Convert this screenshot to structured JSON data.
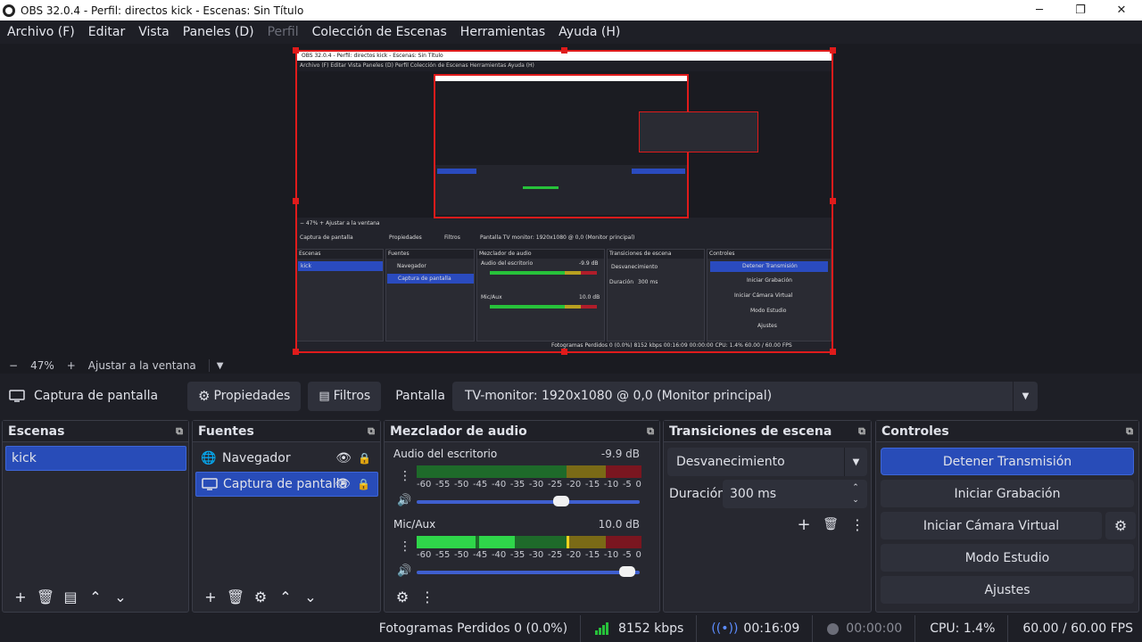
{
  "window": {
    "title": "OBS 32.0.4 - Perfil: directos kick - Escenas: Sin Título",
    "minimize": "─",
    "maximize": "❐",
    "close": "✕"
  },
  "menu": {
    "archivo": "Archivo (F)",
    "editar": "Editar",
    "vista": "Vista",
    "paneles": "Paneles (D)",
    "perfil": "Perfil",
    "coleccion": "Colección de Escenas",
    "herramientas": "Herramientas",
    "ayuda": "Ayuda (H)"
  },
  "zoom": {
    "minus": "−",
    "level": "47%",
    "plus": "+",
    "fit_label": "Ajustar a la ventana",
    "dropdown": "▼"
  },
  "context": {
    "source_icon": "monitor-icon",
    "source_name": "Captura de pantalla",
    "properties_label": "Propiedades",
    "filters_label": "Filtros",
    "display_label": "Pantalla",
    "display_value": "TV-monitor: 1920x1080 @ 0,0 (Monitor principal)"
  },
  "scenes": {
    "title": "Escenas",
    "items": [
      "kick"
    ]
  },
  "sources": {
    "title": "Fuentes",
    "items": [
      {
        "name": "Navegador",
        "icon": "globe-icon",
        "selected": false
      },
      {
        "name": "Captura de pantalla",
        "icon": "monitor-icon",
        "selected": true
      }
    ]
  },
  "mixer": {
    "title": "Mezclador de audio",
    "channels": [
      {
        "name": "Audio del escritorio",
        "db": "-9.9 dB",
        "volume": 0.66
      },
      {
        "name": "Mic/Aux",
        "db": "10.0 dB",
        "volume": 0.98
      }
    ],
    "ticks": [
      "-60",
      "-55",
      "-50",
      "-45",
      "-40",
      "-35",
      "-30",
      "-25",
      "-20",
      "-15",
      "-10",
      "-5",
      "0"
    ]
  },
  "transitions": {
    "title": "Transiciones de escena",
    "type": "Desvanecimiento",
    "duration_label": "Duración",
    "duration_value": "300 ms"
  },
  "controls": {
    "title": "Controles",
    "stop_stream": "Detener Transmisión",
    "start_record": "Iniciar Grabación",
    "start_vcam": "Iniciar Cámara Virtual",
    "studio_mode": "Modo Estudio",
    "settings": "Ajustes"
  },
  "status": {
    "dropped_frames": "Fotogramas Perdidos 0 (0.0%)",
    "bitrate": "8152 kbps",
    "stream_time": "00:16:09",
    "record_time": "00:00:00",
    "cpu": "CPU: 1.4%",
    "fps": "60.00 / 60.00 FPS"
  },
  "preview_mini": {
    "title": "OBS 32.0.4 - Perfil: directos kick - Escenas: Sin Título",
    "menu": "Archivo (F)   Editar   Vista   Paneles (D)   Perfil   Colección de Escenas   Herramientas   Ayuda (H)",
    "zoom": "−   47%   +   Ajustar a la ventana",
    "source": "Captura de pantalla",
    "props": "Propiedades",
    "filters": "Filtros",
    "display": "Pantalla   TV monitor: 1920x1080 @ 0,0 (Monitor principal)",
    "scenes": "Escenas",
    "scene_item": "kick",
    "sources": "Fuentes",
    "source1": "Navegador",
    "source2": "Captura de pantalla",
    "mixer": "Mezclador de audio",
    "ch1": "Audio del escritorio",
    "ch1db": "-9.9 dB",
    "ch2": "Mic/Aux",
    "ch2db": "10.0 dB",
    "trans": "Transiciones de escena",
    "trans_type": "Desvanecimiento",
    "dur": "Duración",
    "dur_value": "300 ms",
    "controls": "Controles",
    "c1": "Detener Transmisión",
    "c2": "Iniciar Grabación",
    "c3": "Iniciar Cámara Virtual",
    "c4": "Modo Estudio",
    "c5": "Ajustes",
    "status": "Fotogramas Perdidos 0 (0.0%)   8152 kbps   00:16:09   00:00:00   CPU: 1.4%   60.00 / 60.00 FPS"
  }
}
